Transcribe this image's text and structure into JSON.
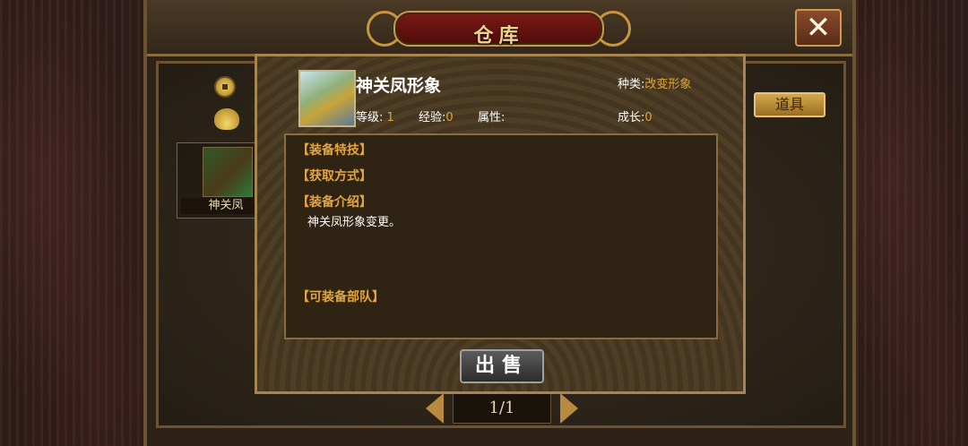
{
  "window": {
    "title": "仓库",
    "close_glyph": "✕"
  },
  "sidebar": {
    "icons": [
      "coin-icon",
      "ingot-icon"
    ]
  },
  "inventory": {
    "items": [
      {
        "label": "神关凤"
      }
    ]
  },
  "tab": {
    "label": "道具"
  },
  "pager": {
    "text": "1/1"
  },
  "detail": {
    "name": "神关凤形象",
    "type_label": "种类:",
    "type_value": "改变形象",
    "level_label": "等级:",
    "level_value": "1",
    "exp_label": "经验:",
    "exp_value": "0",
    "attr_label": "属性:",
    "growth_label": "成长:",
    "growth_value": "0",
    "sections": {
      "skill": "【装备特技】",
      "obtain": "【获取方式】",
      "intro": "【装备介绍】",
      "troops": "【可装备部队】"
    },
    "intro_text": "神关凤形象变更。",
    "sell_label": "出售"
  }
}
